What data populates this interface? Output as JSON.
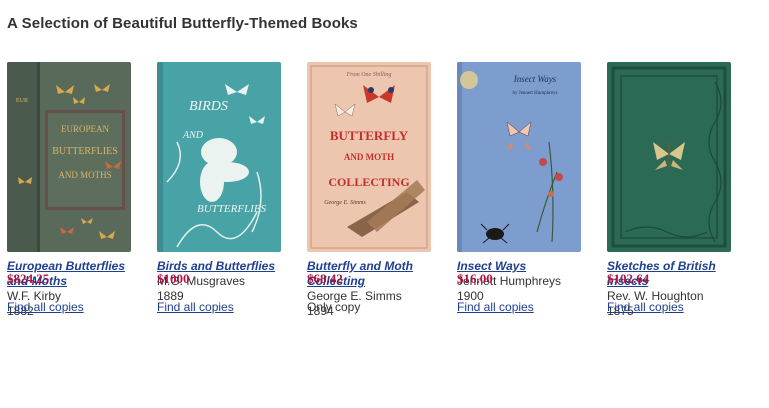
{
  "page": {
    "title": "A Selection of Beautiful Butterfly-Themed Books"
  },
  "books": [
    {
      "title_line1": "European Butterflies",
      "title_line2": "and Moths",
      "author": "W.F. Kirby",
      "year": "1882",
      "price": "$824.25",
      "action": "Find all copies",
      "cover_color": "#5b6c58"
    },
    {
      "title_line1": "Birds and Butterflies",
      "title_line2": "",
      "author": "M.G. Musgraves",
      "year": "1889",
      "price": "$1000",
      "action": "Find all copies",
      "cover_color": "#4aa4a8"
    },
    {
      "title_line1": "Butterfly and Moth",
      "title_line2": "Collecting",
      "author": "George E. Simms",
      "year": "1894",
      "price": "$68.42",
      "action": "Only copy",
      "cover_color": "#e9c3ac"
    },
    {
      "title_line1": "Insect Ways",
      "title_line2": "",
      "author": "Jennett Humphreys",
      "year": "1900",
      "price": "$16.00",
      "action": "Find all copies",
      "cover_color": "#7f9fd0"
    },
    {
      "title_line1": "Sketches of British",
      "title_line2": "Insects",
      "author": "Rev. W. Houghton",
      "year": "1875",
      "price": "$102.64",
      "action": "Find all copies",
      "cover_color": "#2d6b55"
    }
  ],
  "covers": {
    "book1": {
      "text_line1": "EUROPEAN",
      "text_line2": "BUTTERFLIES",
      "text_line3": "AND MOTHS"
    },
    "book2": {
      "text_line1": "BIRDS",
      "text_line2": "AND",
      "text_line3": "BUTTERFLIES"
    },
    "book3": {
      "text_line0": "From One Shilling",
      "text_line1": "BUTTERFLY",
      "text_line2": "AND MOTH",
      "text_line3": "COLLECTING",
      "text_line4": "George E. Simms"
    },
    "book4": {
      "text_line1": "Insect Ways",
      "text_line2": "by Jennett Humphreys"
    }
  }
}
